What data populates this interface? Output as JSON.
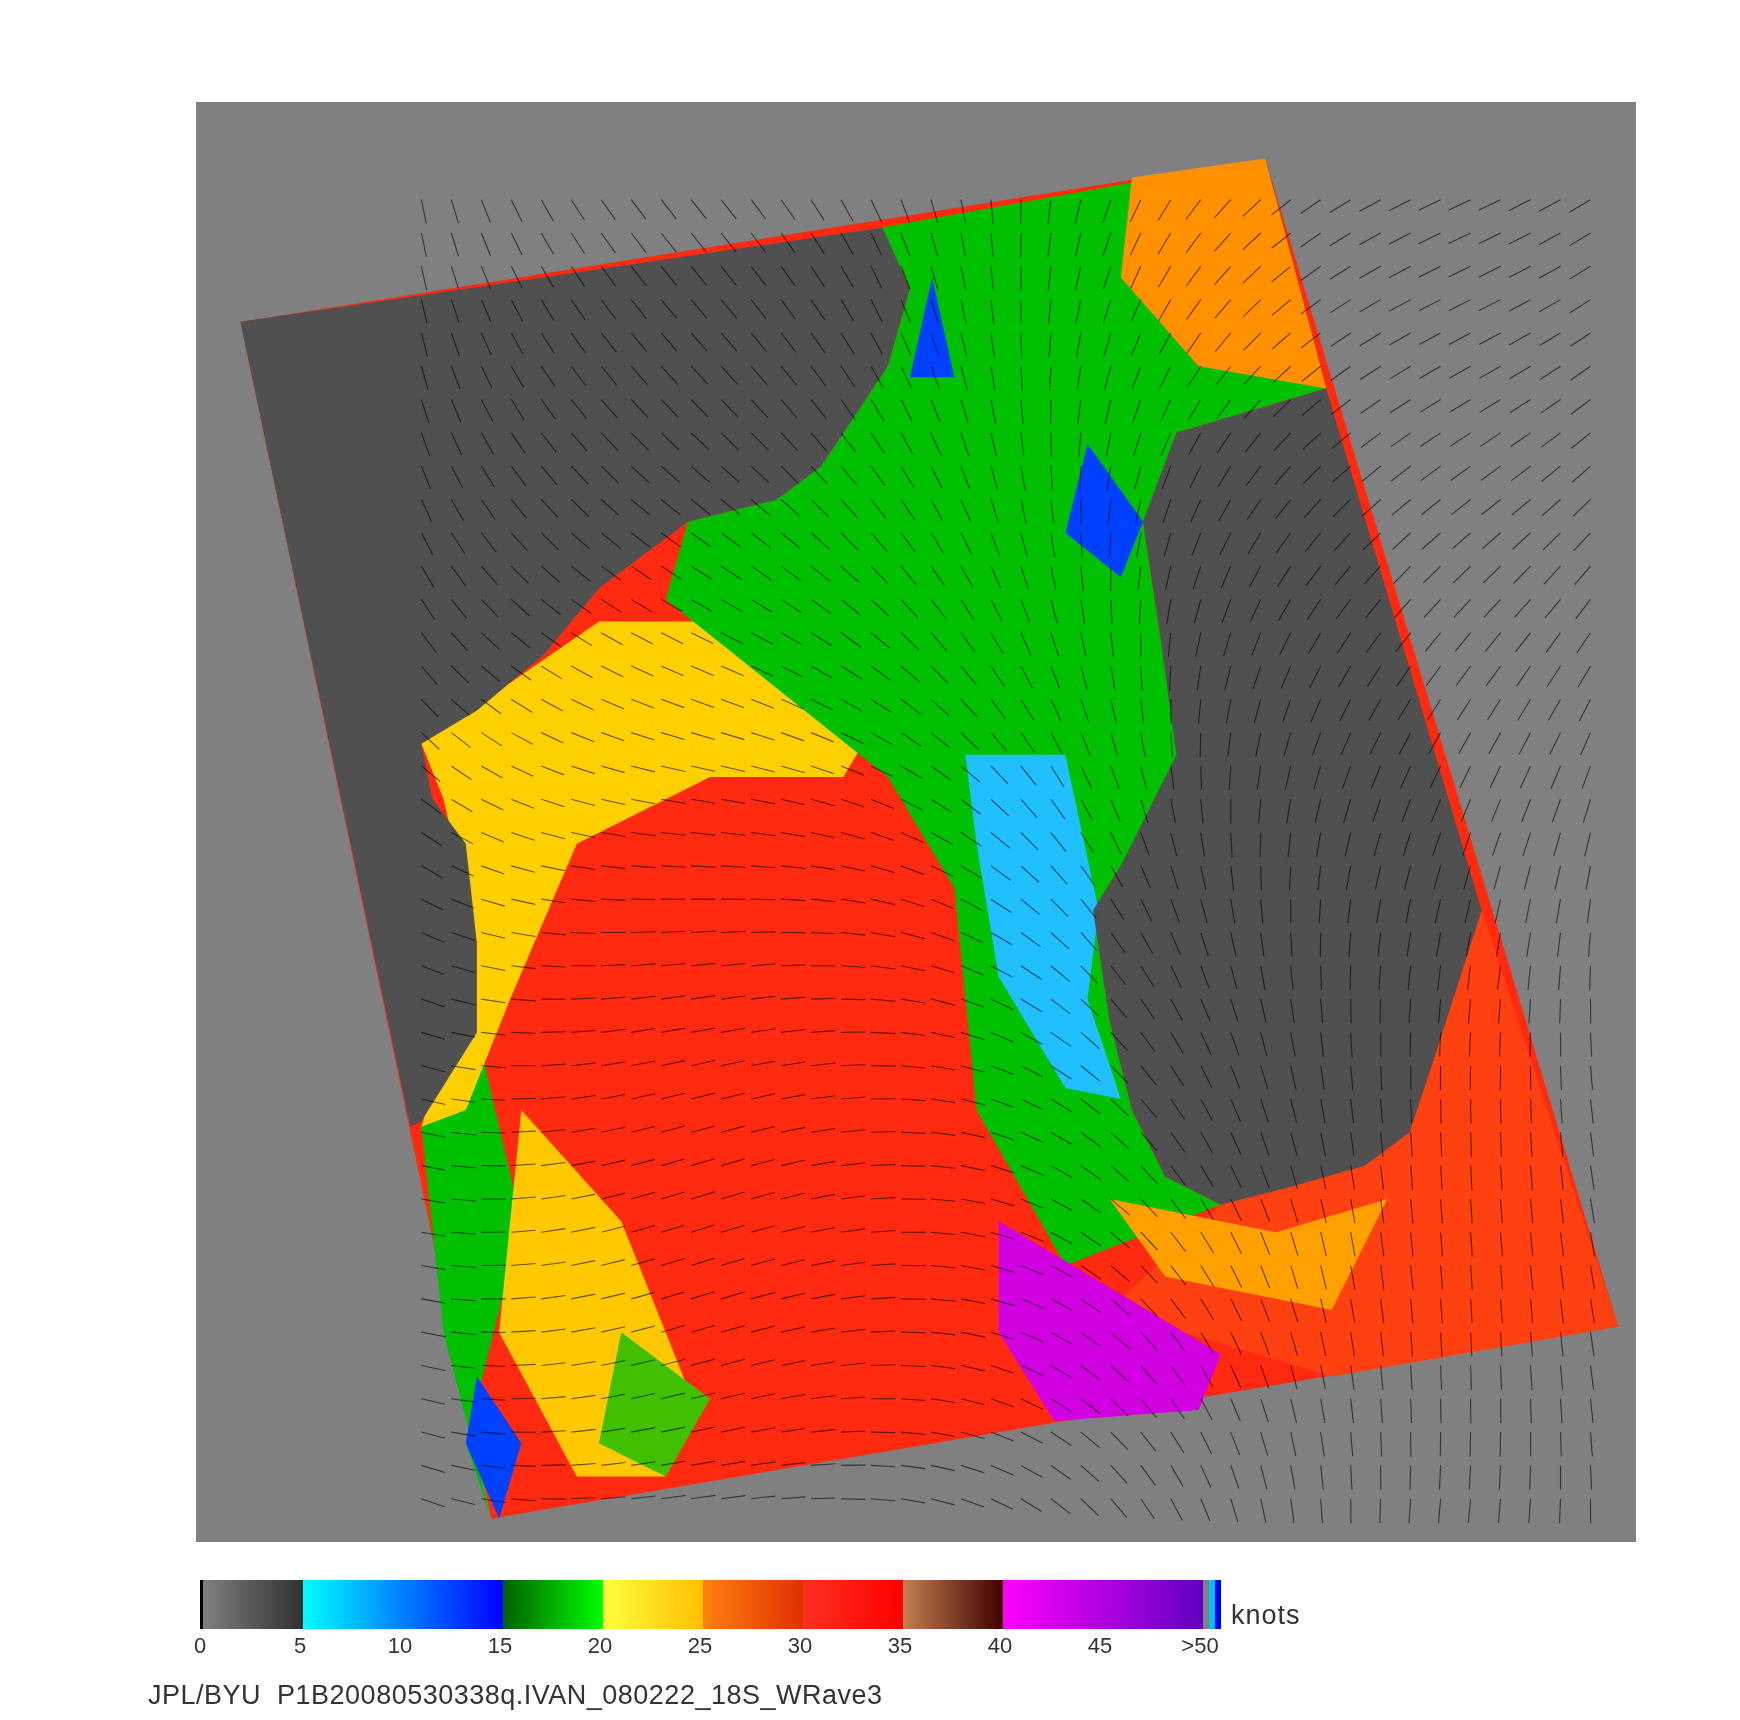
{
  "colorbar": {
    "unit": "knots",
    "ticks": [
      "0",
      "5",
      "10",
      "15",
      "20",
      "25",
      "30",
      "35",
      "40",
      "45",
      ">50"
    ]
  },
  "caption": "JPL/BYU  P1B20080530338q.IVAN_080222_18S_WRave3"
}
